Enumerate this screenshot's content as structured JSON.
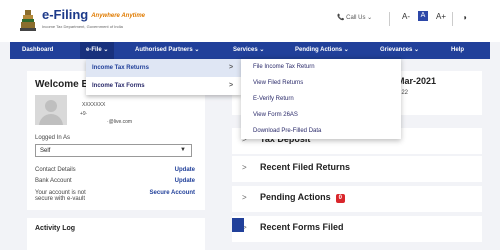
{
  "header": {
    "logo_text": "e-Filing",
    "tagline": "Anywhere Anytime",
    "subtitle": "Income Tax Department, Government of India",
    "call_us": "Call Us",
    "call_caret": "⌄",
    "font_decrease": "A-",
    "font_normal": "A",
    "font_increase": "A+",
    "contrast_icon": "◑"
  },
  "nav": {
    "items": [
      {
        "label": "Dashboard"
      },
      {
        "label": "e-File ⌄"
      },
      {
        "label": "Authorised Partners ⌄"
      },
      {
        "label": "Services ⌄"
      },
      {
        "label": "Pending Actions ⌄"
      },
      {
        "label": "Grievances ⌄"
      },
      {
        "label": "Help"
      }
    ]
  },
  "efile_menu": {
    "items": [
      {
        "label": "Income Tax Returns",
        "arrow": ">"
      },
      {
        "label": "Income Tax Forms",
        "arrow": ">"
      }
    ]
  },
  "itr_submenu": {
    "items": [
      {
        "label": "File Income Tax Return"
      },
      {
        "label": "View Filed Returns"
      },
      {
        "label": "E-Verify Return"
      },
      {
        "label": "View Form 26AS"
      },
      {
        "label": "Download Pre-Filled Data"
      }
    ]
  },
  "profile": {
    "welcome": "Welcome B",
    "name": "XXXXXXX",
    "phone": "+9·",
    "email": "·@live.com",
    "logged_in_as_label": "Logged In As",
    "logged_in_as_value": "Self",
    "contact_details": "Contact Details",
    "contact_update": "Update",
    "bank_account": "Bank Account",
    "bank_update": "Update",
    "account_warning_line1": "Your account is not",
    "account_warning_line2": "secure with e-vault",
    "secure_account": "Secure Account",
    "activity_log": "Activity Log"
  },
  "main": {
    "date_text": "Mar-2021",
    "year_text": "022",
    "left_fragment": "Fo",
    "sections": [
      {
        "chevron": ">",
        "title": "Tax Deposit"
      },
      {
        "chevron": ">",
        "title": "Recent Filed Returns"
      },
      {
        "chevron": ">",
        "title": "Pending Actions",
        "badge": "0"
      },
      {
        "chevron": ">",
        "title": "Recent Forms Filed"
      }
    ]
  },
  "colors": {
    "nav_bg": "#21409a",
    "highlight_bg": "#dfe6f4",
    "badge": "#d9262b"
  }
}
